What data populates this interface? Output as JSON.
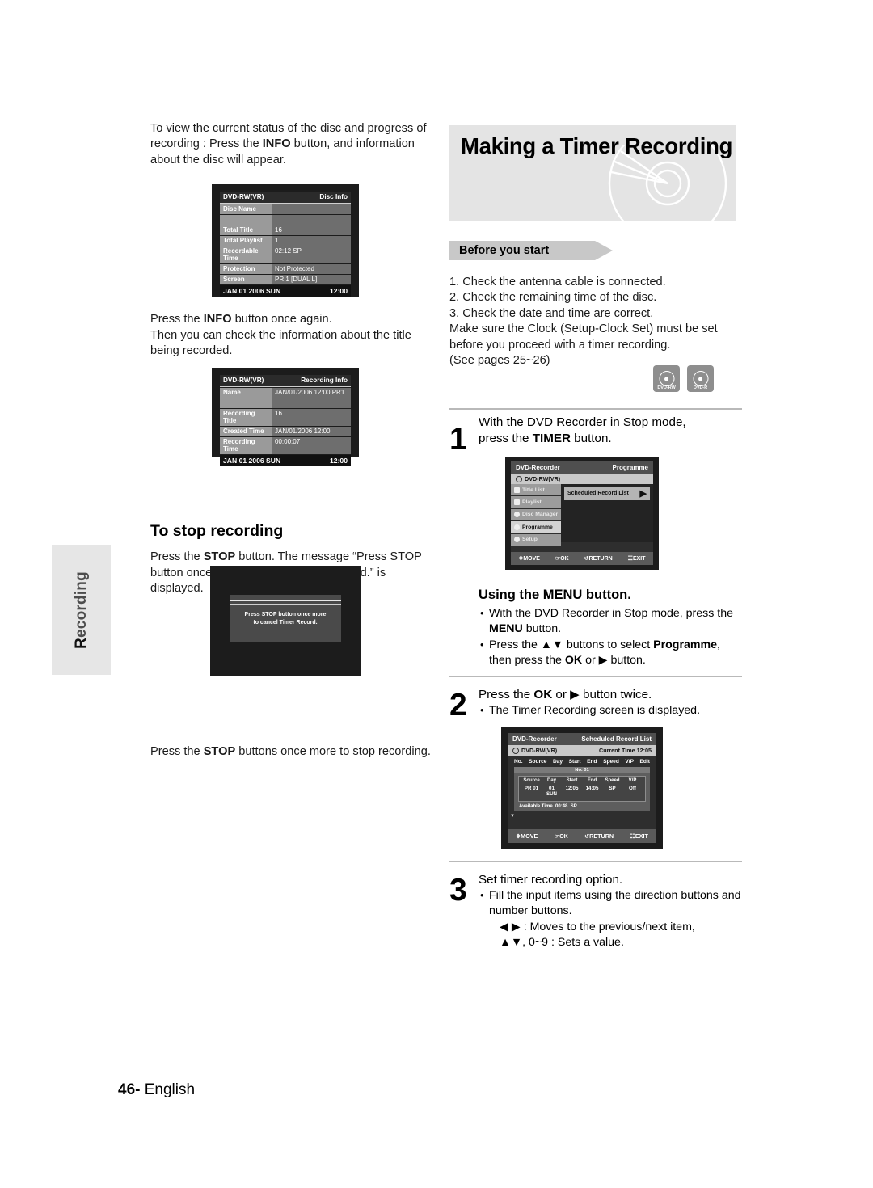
{
  "side_tab": {
    "label_cap": "R",
    "label_rest": "ecording"
  },
  "left": {
    "intro_p1": "To view the current status of the disc and progress of recording : Press the ",
    "intro_p1_bold": "INFO",
    "intro_p1_end": " button, and information about the disc will appear.",
    "intro_p2_start": "Press the ",
    "intro_p2_bold": "INFO",
    "intro_p2_end": " button once again.",
    "intro_p2_line2": "Then you can check the information about the title being recorded.",
    "stop_heading": "To stop recording",
    "stop_p_start": "Press the ",
    "stop_p_bold": "STOP",
    "stop_p_end": " button. The message “Press STOP button once more to cancel Timer Record.” is displayed.",
    "stop_p2_start": "Press the ",
    "stop_p2_bold": "STOP",
    "stop_p2_end": " buttons once more to stop recording."
  },
  "disc_info_screen": {
    "disc_type": "DVD-RW(VR)",
    "title": "Disc Info",
    "rows": [
      {
        "label": "Disc Name",
        "value": ""
      },
      {
        "label": "",
        "value": ""
      },
      {
        "label": "Total Title",
        "value": "16"
      },
      {
        "label": "Total Playlist",
        "value": "1"
      },
      {
        "label": "Recordable Time",
        "value": "02:12 SP"
      },
      {
        "label": "Protection",
        "value": "Not Protected"
      },
      {
        "label": "Screen",
        "value": "PR 1 [DUAL L]"
      }
    ],
    "footer_date": "JAN 01 2006 SUN",
    "footer_time": "12:00"
  },
  "rec_info_screen": {
    "disc_type": "DVD-RW(VR)",
    "title": "Recording Info",
    "rows": [
      {
        "label": "Name",
        "value": "JAN/01/2006 12:00 PR1"
      },
      {
        "label": "",
        "value": ""
      },
      {
        "label": "Recording Title",
        "value": "16"
      },
      {
        "label": "Created Time",
        "value": "JAN/01/2006 12:00"
      },
      {
        "label": "Recording Time",
        "value": "00:00:07"
      }
    ],
    "footer_date": "JAN 01 2006 SUN",
    "footer_time": "12:00"
  },
  "stop_dialog_screen": {
    "line1": "Press STOP button once more",
    "line2": "to cancel Timer Record."
  },
  "right": {
    "page_title": "Making a Timer Recording",
    "before_you_start": "Before you start",
    "checklist": [
      "1. Check the antenna cable is connected.",
      "2. Check the remaining time of the disc.",
      "3. Check the date and time are correct.",
      "Make sure the Clock (Setup-Clock Set) must be set",
      "before you proceed with a timer recording.",
      "(See pages 25~26)"
    ],
    "badges": [
      {
        "label": "DVD-RW"
      },
      {
        "label": "DVD-R"
      }
    ],
    "step1": {
      "number": "1",
      "line1": "With the DVD Recorder in Stop mode,",
      "line2_start": "press the ",
      "line2_bold": "TIMER",
      "line2_end": " button."
    },
    "menu_section": {
      "heading": "Using the MENU button.",
      "bullets": [
        {
          "a": "With the DVD Recorder in Stop mode, press the ",
          "b": "MENU",
          "c": " button."
        },
        {
          "a": "Press the ▲▼ buttons to select ",
          "b": "Programme",
          "c": ", then press the ",
          "d": "OK",
          "e": " or  ▶ button."
        }
      ]
    },
    "step2": {
      "number": "2",
      "line1_start": "Press the ",
      "line1_bold": "OK",
      "line1_mid": " or ▶ button twice.",
      "bullet": "The Timer Recording screen is displayed."
    },
    "step3": {
      "number": "3",
      "heading": "Set timer recording option.",
      "bullet": "Fill the input items using the direction buttons and number buttons.",
      "sub1": "◀ ▶ : Moves to the previous/next item,",
      "sub2": "▲▼, 0~9 : Sets a value."
    }
  },
  "programme_screen": {
    "brand": "DVD-Recorder",
    "title": "Programme",
    "disc_type": "DVD-RW(VR)",
    "menu_items": [
      {
        "label": "Title List",
        "selected": false
      },
      {
        "label": "Playlist",
        "selected": false
      },
      {
        "label": "Disc Manager",
        "selected": false
      },
      {
        "label": "Programme",
        "selected": true
      },
      {
        "label": "Setup",
        "selected": false
      }
    ],
    "selected_entry": "Scheduled Record List",
    "selected_entry_arrow": "▶",
    "footer": [
      {
        "icon": "✥",
        "label": "MOVE"
      },
      {
        "icon": "☞",
        "label": "OK"
      },
      {
        "icon": "↺",
        "label": "RETURN"
      },
      {
        "icon": "☷",
        "label": "EXIT"
      }
    ]
  },
  "schedule_screen": {
    "brand": "DVD-Recorder",
    "title": "Scheduled Record List",
    "disc_type": "DVD-RW(VR)",
    "current_time_label": "Current Time",
    "current_time": "12:05",
    "columns": [
      "No.",
      "Source",
      "Day",
      "Start",
      "End",
      "Speed",
      "V/P",
      "Edit"
    ],
    "entry_no": "No. 01",
    "field_headers": [
      "Source",
      "Day",
      "Start",
      "End",
      "Speed",
      "V/P"
    ],
    "field_values": [
      "PR 01",
      "01 SUN",
      "12:05",
      "14:05",
      "SP",
      "Off"
    ],
    "available_time_label": "Available Time",
    "available_time": "00:48",
    "available_speed": "SP",
    "footer": [
      {
        "icon": "✥",
        "label": "MOVE"
      },
      {
        "icon": "☞",
        "label": "OK"
      },
      {
        "icon": "↺",
        "label": "RETURN"
      },
      {
        "icon": "☷",
        "label": "EXIT"
      }
    ]
  },
  "footer": {
    "page_number": "46",
    "dash": "- ",
    "language": "English"
  },
  "colors": {
    "banner_bg": "#e4e4e4",
    "chevron_bg": "#c8c8c8",
    "side_tab_bg": "#e6e6e6",
    "rule": "#b9b9b9"
  }
}
